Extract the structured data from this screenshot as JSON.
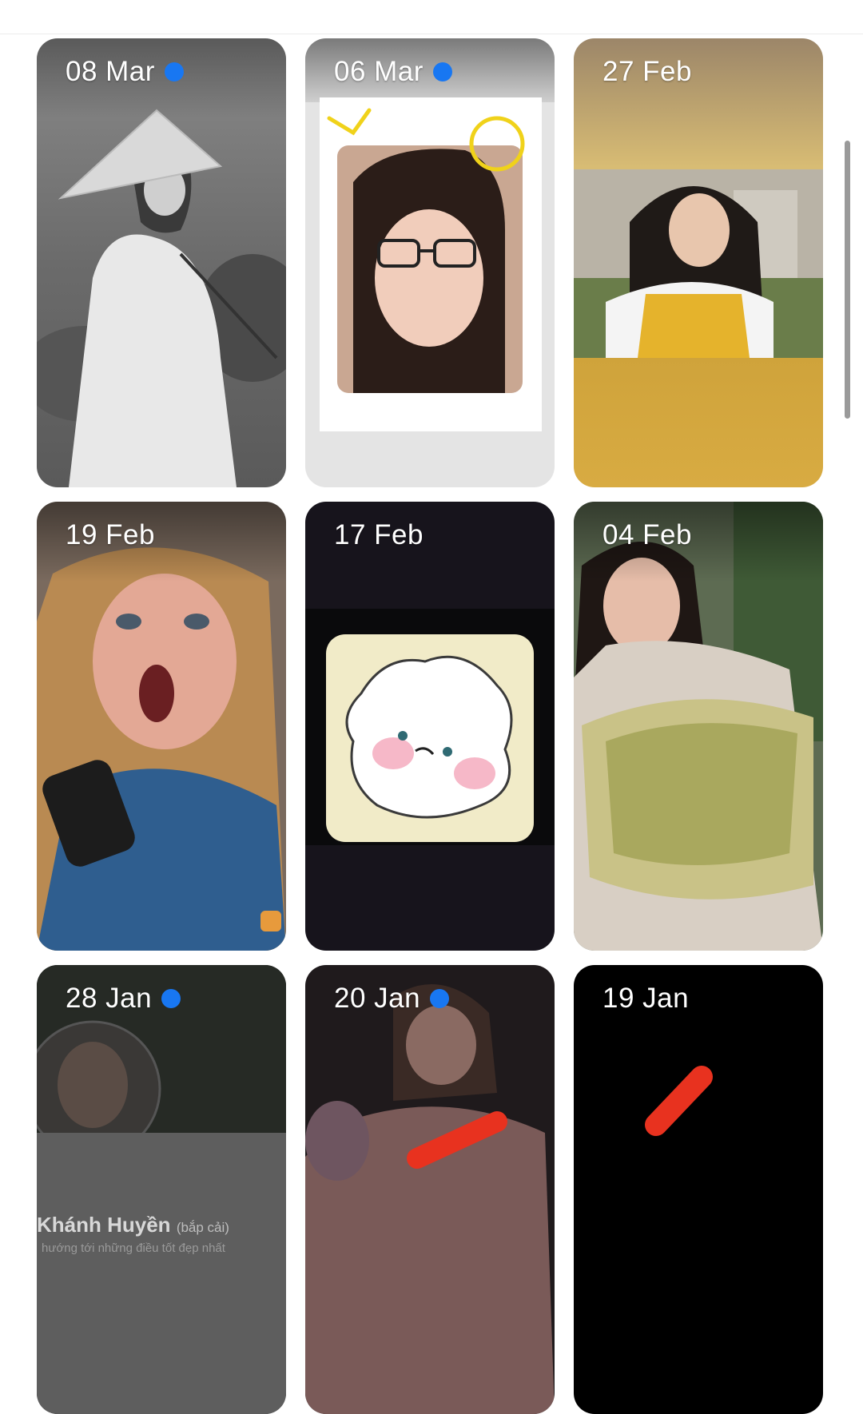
{
  "stories": [
    {
      "date": "08 Mar",
      "unseen": true
    },
    {
      "date": "06 Mar",
      "unseen": true
    },
    {
      "date": "27 Feb",
      "unseen": false
    },
    {
      "date": "19 Feb",
      "unseen": false
    },
    {
      "date": "17 Feb",
      "unseen": false
    },
    {
      "date": "04 Feb",
      "unseen": false
    },
    {
      "date": "28 Jan",
      "unseen": true
    },
    {
      "date": "20 Jan",
      "unseen": true
    },
    {
      "date": "19 Jan",
      "unseen": false
    }
  ],
  "profile_card": {
    "name": "Khánh Huyền",
    "nickname": "(bắp cải)",
    "subtitle": "hướng tới những điều tốt đẹp nhất"
  },
  "colors": {
    "unseen_dot": "#1877f2",
    "redaction": "#e8321f"
  }
}
